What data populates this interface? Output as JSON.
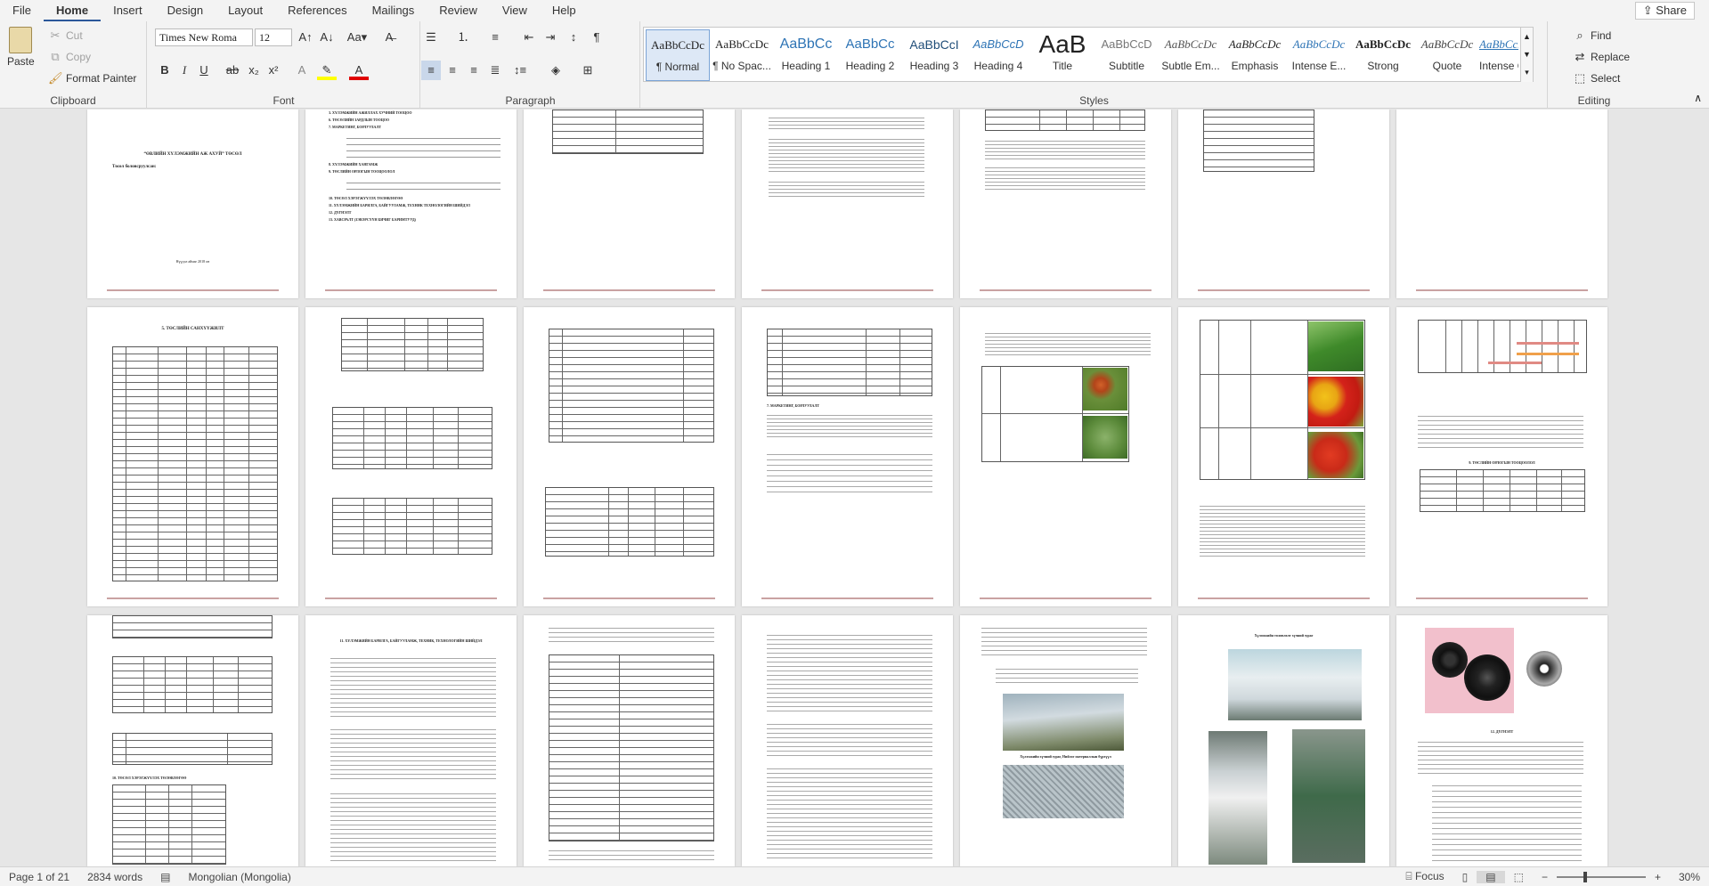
{
  "menu": {
    "tabs": [
      "File",
      "Home",
      "Insert",
      "Design",
      "Layout",
      "References",
      "Mailings",
      "Review",
      "View",
      "Help"
    ],
    "share": "Share"
  },
  "clipboard": {
    "paste": "Paste",
    "cut": "Cut",
    "copy": "Copy",
    "format_painter": "Format Painter",
    "label": "Clipboard"
  },
  "font": {
    "family": "Times New Roma",
    "size": "12",
    "label": "Font"
  },
  "paragraph": {
    "label": "Paragraph"
  },
  "styles": {
    "label": "Styles",
    "items": [
      {
        "preview": "AaBbCcDc",
        "name": "¶ Normal"
      },
      {
        "preview": "AaBbCcDc",
        "name": "¶ No Spac..."
      },
      {
        "preview": "AaBbCc",
        "name": "Heading 1"
      },
      {
        "preview": "AaBbCc",
        "name": "Heading 2"
      },
      {
        "preview": "AaBbCcI",
        "name": "Heading 3"
      },
      {
        "preview": "AaBbCcD",
        "name": "Heading 4"
      },
      {
        "preview": "AaB",
        "name": "Title"
      },
      {
        "preview": "AaBbCcD",
        "name": "Subtitle"
      },
      {
        "preview": "AaBbCcDc",
        "name": "Subtle Em..."
      },
      {
        "preview": "AaBbCcDc",
        "name": "Emphasis"
      },
      {
        "preview": "AaBbCcDc",
        "name": "Intense E..."
      },
      {
        "preview": "AaBbCcDc",
        "name": "Strong"
      },
      {
        "preview": "AaBbCcDc",
        "name": "Quote"
      },
      {
        "preview": "AaBbCcDc",
        "name": "Intense Q..."
      }
    ]
  },
  "editing": {
    "find": "Find",
    "replace": "Replace",
    "select": "Select",
    "label": "Editing"
  },
  "pages": {
    "title_heading": "“ӨВЛИЙН ХҮЛЭМЖИЙН АЖ АХУЙ” ТӨСӨЛ",
    "title_sub": "Төсөл боловсруулсан:",
    "title_year": "Нүүдэл аймаг 2018 он",
    "toc_items": [
      "3. ХҮЛЭМЖИЙН АЖИЛЛАХ ХУЧНИЙ ТООЦОО",
      "6. ТӨСӨЛИЙН ЗАРДЛЫН ТООЦОО",
      "7. МАРКЕТИНГ, БОРЛУУЛАЛТ",
      "8. ХҮЛЭМЖИЙН ХАНГАМЖ",
      "9. ТӨСЛИЙН ОРЛОГЫН ТООЦООЛОЛ",
      "10. ТӨСӨЛ ХЭРЭГЖҮҮЛЭХ ТӨЛӨВЛӨГӨӨ",
      "11. ХҮЛЭМЖИЙН БАРИЛГА, БАЙГУУЛАМЖ, ТЕХНИК ТЕХНОЛОГИЙН ШИЙДЭЛ",
      "12. ДҮГНЭЛТ",
      "13. ХАВСРАЛТ (ЗЭВЭРСҮҮН БИЧИГ БАРИМТУУД)"
    ],
    "sec5": "5. ТӨСЛИЙН САНХҮҮЖИЛТ",
    "sec7": "7. МАРКЕТИНГ, БОРЛУУЛАЛТ",
    "sec10": "10. ТӨСӨЛ ХЭРЭГЖҮҮЛЭХ ТӨЛӨВЛӨГӨӨ",
    "sec11": "11. ХҮЛЭМЖИЙН БАРИЛГА, БАЙГУУЛАМЖ, ТЕХНИК, ТЕХНОЛОГИЙН ШИЙДЭЛ",
    "sec12": "12. ДҮГНЭЛТ",
    "sec9": "9. ТӨСЛИЙН ОРЛОГЫН ТООЦООЛОЛ",
    "caption_1": "Хүлэмжийн хүчний зураг, Нийлэг материаллын бүрхүүл",
    "caption_2": "Хүлэмжийн төлөвлөлт хүчний зураг"
  },
  "status": {
    "page": "Page 1 of 21",
    "words": "2834 words",
    "language": "Mongolian (Mongolia)",
    "focus": "Focus",
    "zoom": "30%"
  }
}
